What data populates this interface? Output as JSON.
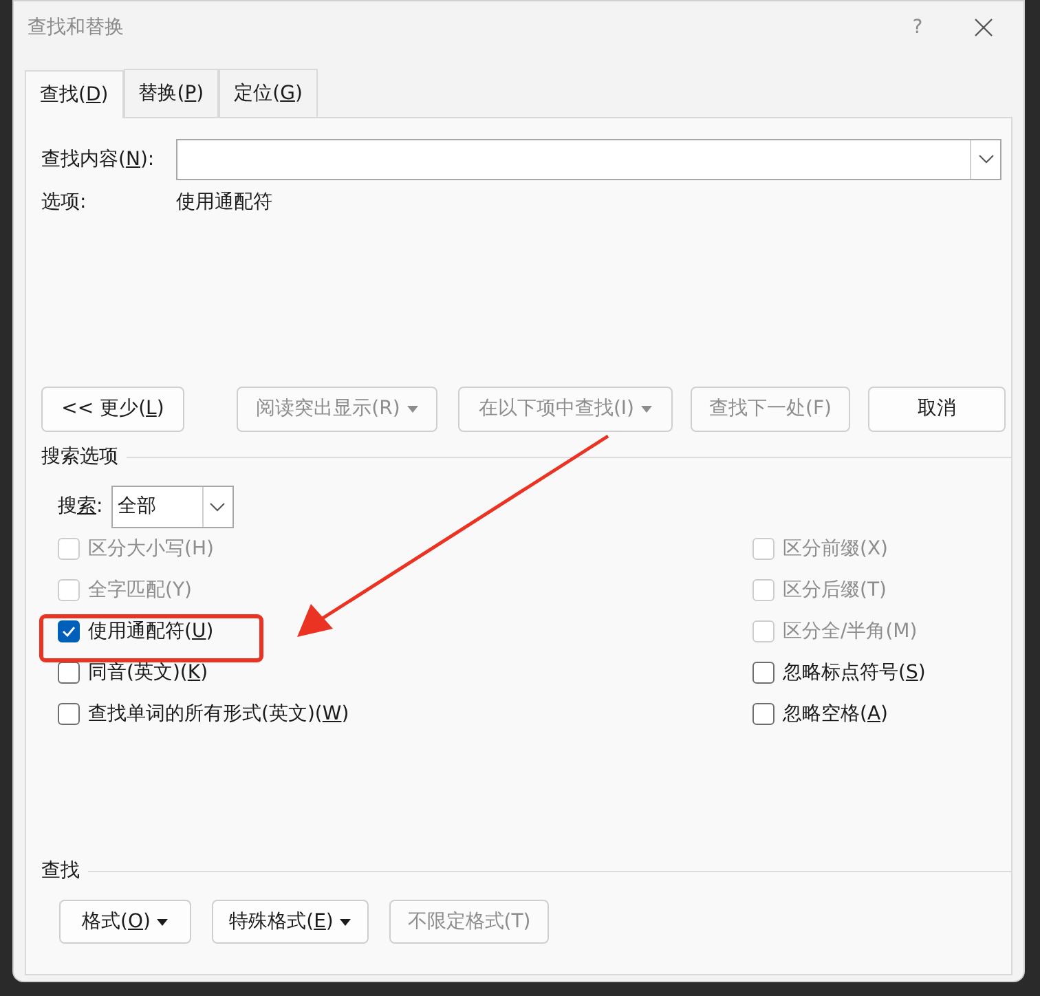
{
  "window": {
    "title": "查找和替换",
    "help": "?"
  },
  "tabs": [
    {
      "label": "查找(D)",
      "underline_key": true,
      "selected": true
    },
    {
      "label": "替换(P)",
      "underline_key": true,
      "selected": false
    },
    {
      "label": "定位(G)",
      "underline_key": true,
      "selected": false
    }
  ],
  "find_field": {
    "label": "查找内容(N):",
    "underline_key": true
  },
  "options_line": {
    "label": "选项:",
    "value": "使用通配符"
  },
  "buttons": [
    {
      "label": "<< 更少(L)",
      "underline_key": true,
      "disabled": false,
      "dropdown": false
    },
    {
      "label": "阅读突出显示(R)",
      "underline_key": false,
      "disabled": true,
      "dropdown": true
    },
    {
      "label": "在以下项中查找(I)",
      "underline_key": false,
      "disabled": true,
      "dropdown": true
    },
    {
      "label": "查找下一处(F)",
      "underline_key": false,
      "disabled": true,
      "dropdown": false
    },
    {
      "label": "取消",
      "disabled": false,
      "dropdown": false
    }
  ],
  "search_options": {
    "title": "搜索选项",
    "search_label": "搜索:",
    "search_value": "全部",
    "left": [
      {
        "label": "区分大小写(H)",
        "underline_key": false,
        "disabled": true,
        "checked": false
      },
      {
        "label": "全字匹配(Y)",
        "underline_key": false,
        "disabled": true,
        "checked": false
      },
      {
        "label": "使用通配符(U)",
        "underline_key": true,
        "disabled": false,
        "checked": true
      },
      {
        "label": "同音(英文)(K)",
        "underline_key": true,
        "disabled": false,
        "checked": false
      },
      {
        "label": "查找单词的所有形式(英文)(W)",
        "underline_key": true,
        "disabled": false,
        "checked": false
      }
    ],
    "right": [
      {
        "label": "区分前缀(X)",
        "underline_key": false,
        "disabled": true,
        "checked": false
      },
      {
        "label": "区分后缀(T)",
        "underline_key": false,
        "disabled": true,
        "checked": false
      },
      {
        "label": "区分全/半角(M)",
        "underline_key": false,
        "disabled": true,
        "checked": false
      },
      {
        "label": "忽略标点符号(S)",
        "underline_key": true,
        "disabled": false,
        "checked": false
      },
      {
        "label": "忽略空格(A)",
        "underline_key": true,
        "disabled": false,
        "checked": false
      }
    ]
  },
  "find_section": {
    "title": "查找",
    "buttons": [
      {
        "label": "格式(O)",
        "underline_key": true,
        "disabled": false,
        "dropdown": true
      },
      {
        "label": "特殊格式(E)",
        "underline_key": true,
        "disabled": false,
        "dropdown": true
      },
      {
        "label": "不限定格式(T)",
        "underline_key": false,
        "disabled": true,
        "dropdown": false
      }
    ]
  },
  "annotation": {
    "kind": "arrow-to-box"
  }
}
